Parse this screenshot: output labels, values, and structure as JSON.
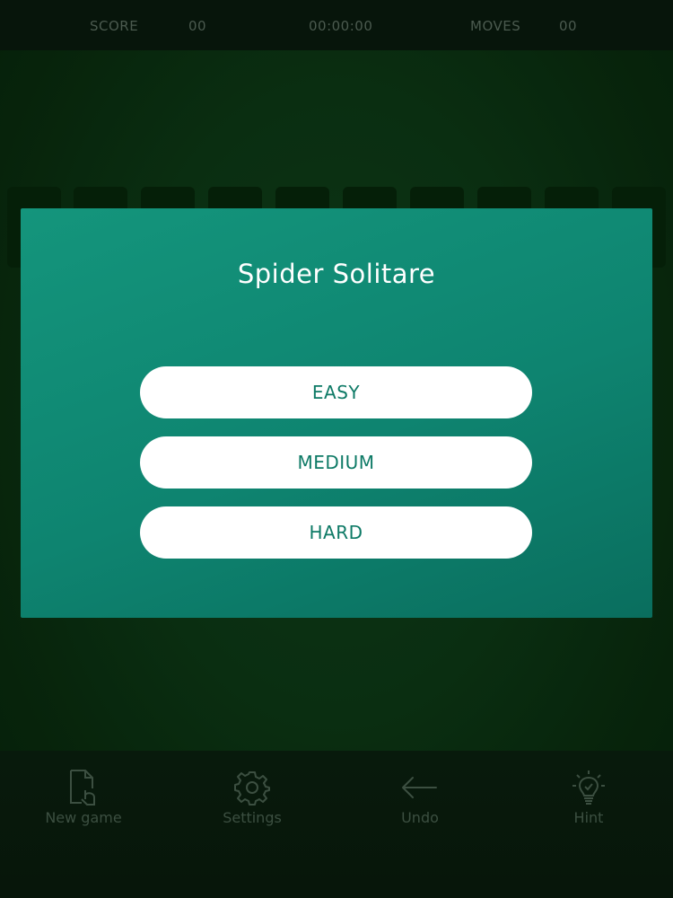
{
  "top_bar": {
    "score_label": "SCORE",
    "score_value": "00",
    "timer": "00:00:00",
    "moves_label": "MOVES",
    "moves_value": "00"
  },
  "modal": {
    "title": "Spider Solitare",
    "buttons": [
      "EASY",
      "MEDIUM",
      "HARD"
    ]
  },
  "toolbar": {
    "items": [
      {
        "label": "New game",
        "icon": "new-game-icon"
      },
      {
        "label": "Settings",
        "icon": "gear-icon"
      },
      {
        "label": "Undo",
        "icon": "undo-arrow-icon"
      },
      {
        "label": "Hint",
        "icon": "lightbulb-icon"
      }
    ]
  },
  "colors": {
    "modal_bg": "#11907a",
    "button_text": "#0e7a66",
    "table_bg": "#0b3213"
  }
}
